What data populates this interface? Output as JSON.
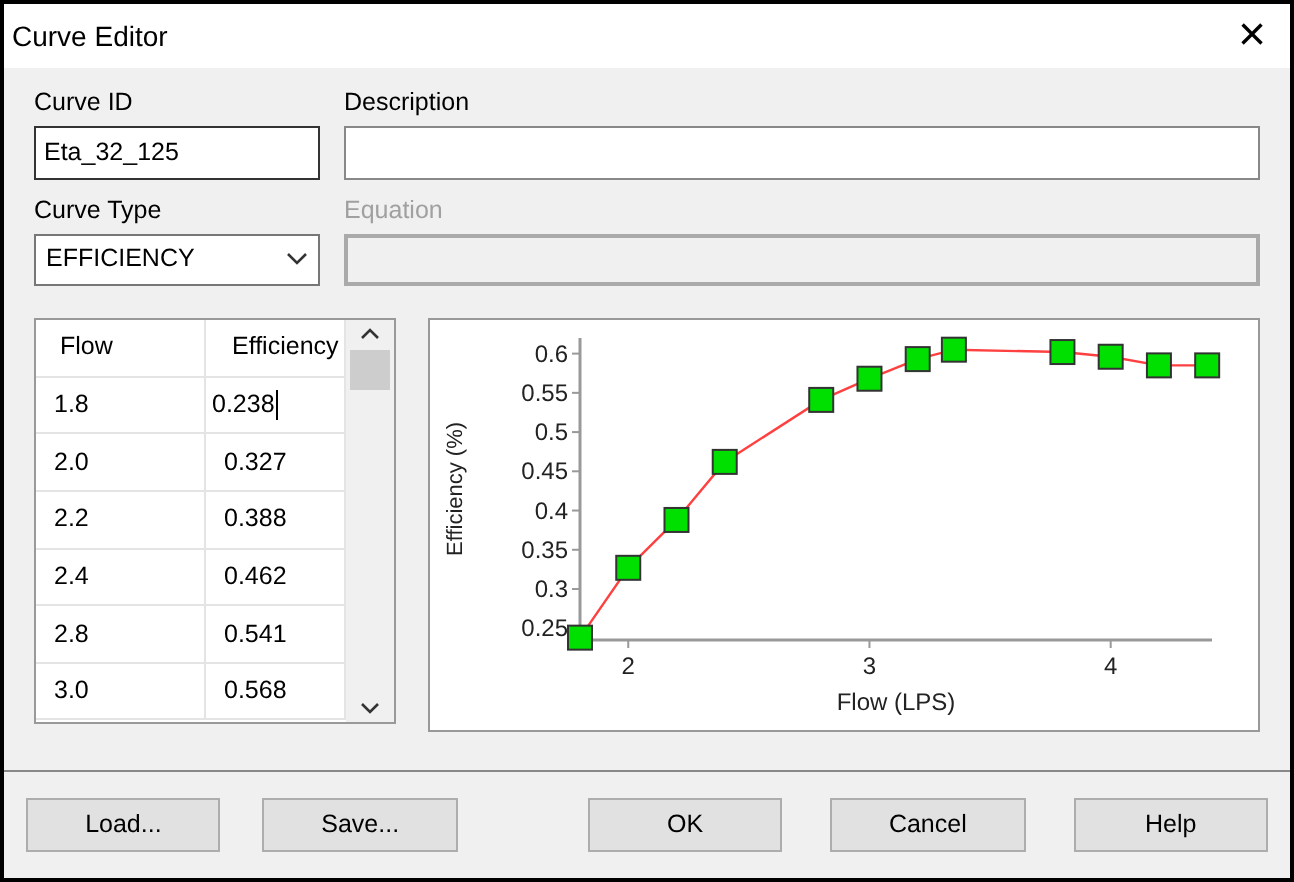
{
  "window": {
    "title": "Curve Editor",
    "close": "×"
  },
  "curve_id": {
    "label": "Curve ID",
    "value": "Eta_32_125"
  },
  "description": {
    "label": "Description"
  },
  "curve_type": {
    "label": "Curve Type",
    "value": "EFFICIENCY"
  },
  "equation": {
    "label": "Equation",
    "disabled": true
  },
  "table": {
    "columns": [
      "Flow",
      "Efficiency"
    ],
    "rows": [
      {
        "cells": [
          "1.8",
          "0.238"
        ],
        "editing": true
      },
      {
        "cells": [
          "2.0",
          "0.327"
        ],
        "editing": false
      },
      {
        "cells": [
          "2.2",
          "0.388"
        ],
        "editing": false
      },
      {
        "cells": [
          "2.4",
          "0.462"
        ],
        "editing": false
      },
      {
        "cells": [
          "2.8",
          "0.541"
        ],
        "editing": false
      },
      {
        "cells": [
          "3.0",
          "0.568"
        ],
        "editing": false
      }
    ]
  },
  "chart": {
    "chart_data": {
      "type": "line",
      "xlabel": "Flow (LPS)",
      "ylabel": "Efficiency (%)",
      "x": [
        1.8,
        2.0,
        2.2,
        2.4,
        2.8,
        3.0,
        3.2,
        3.35,
        3.8,
        4.0,
        4.2,
        4.4
      ],
      "series": [
        {
          "color": "#ff4040",
          "marker": "square",
          "values": [
            0.238,
            0.327,
            0.388,
            0.462,
            0.541,
            0.568,
            0.593,
            0.605,
            0.602,
            0.596,
            0.585,
            0.585
          ]
        }
      ],
      "xlim": [
        1.8,
        4.42
      ],
      "ylim": [
        0.235,
        0.62
      ],
      "xticks": [
        2,
        3,
        4
      ],
      "yticks": [
        0.25,
        0.3,
        0.35,
        0.4,
        0.45,
        0.5,
        0.55,
        0.6
      ]
    }
  },
  "buttons": [
    "Load...",
    "Save...",
    "OK",
    "Cancel",
    "Help"
  ]
}
